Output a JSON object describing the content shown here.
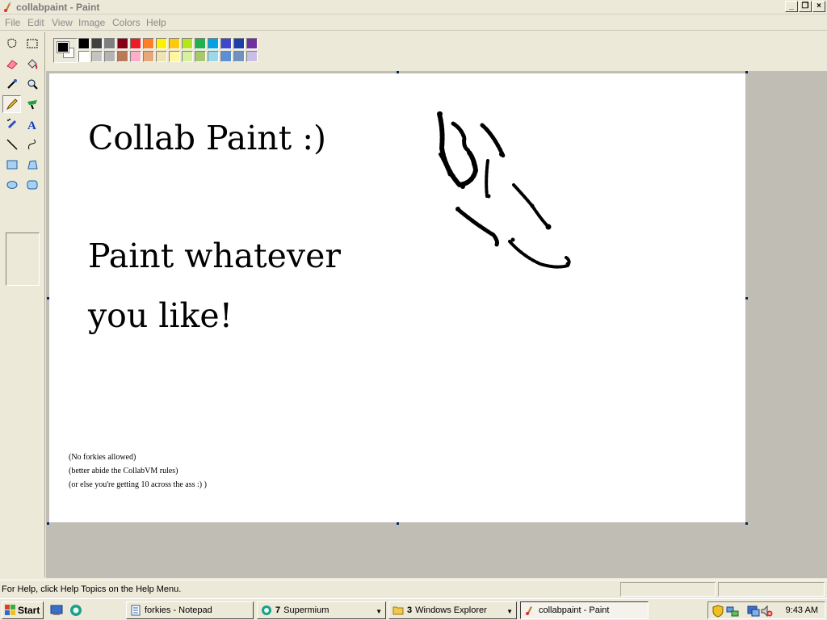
{
  "window": {
    "title": "collabpaint - Paint",
    "minimize_glyph": "_",
    "maximize_glyph": "❐",
    "close_glyph": "×"
  },
  "menu": [
    "File",
    "Edit",
    "View",
    "Image",
    "Colors",
    "Help"
  ],
  "tools": [
    {
      "name": "free-form-select-icon"
    },
    {
      "name": "select-icon"
    },
    {
      "name": "eraser-icon"
    },
    {
      "name": "fill-bucket-icon"
    },
    {
      "name": "color-picker-icon"
    },
    {
      "name": "magnifier-icon"
    },
    {
      "name": "pencil-icon",
      "active": true
    },
    {
      "name": "brush-icon"
    },
    {
      "name": "airbrush-icon"
    },
    {
      "name": "text-icon"
    },
    {
      "name": "line-icon"
    },
    {
      "name": "curve-icon"
    },
    {
      "name": "rectangle-icon"
    },
    {
      "name": "polygon-icon"
    },
    {
      "name": "ellipse-icon"
    },
    {
      "name": "rounded-rectangle-icon"
    }
  ],
  "palette": {
    "foreground": "#000000",
    "background": "#ffffff",
    "row1": [
      "#000000",
      "#404040",
      "#7f7f7f",
      "#880015",
      "#ed1c24",
      "#ff7f27",
      "#fff200",
      "#ffc90e",
      "#b5e61d",
      "#22b14c",
      "#00a2e8",
      "#3f48cc",
      "#1f3fa8",
      "#7030a0"
    ],
    "row2": [
      "#ffffff",
      "#c3c3c3",
      "#b4b4b4",
      "#b97a57",
      "#ffaec9",
      "#e6a878",
      "#efe4b0",
      "#fff6a0",
      "#d6f0a0",
      "#a8c870",
      "#99d9ea",
      "#5b8fd8",
      "#7092be",
      "#c8bfe7"
    ]
  },
  "canvas": {
    "line1": "Collab Paint :)",
    "line2": "Paint whatever",
    "line3": "you like!",
    "small1": "(No forkies allowed)",
    "small2": "(better abide the CollabVM rules)",
    "small3": "(or else you're getting 10 across the ass :) )"
  },
  "status": {
    "help_text": "For Help, click Help Topics on the Help Menu."
  },
  "taskbar": {
    "start_label": "Start",
    "buttons": [
      {
        "label": "forkies - Notepad",
        "count": "",
        "active": false
      },
      {
        "label": "Supermium",
        "count": "7",
        "active": false
      },
      {
        "label": "Windows Explorer",
        "count": "3",
        "active": false
      },
      {
        "label": "collabpaint - Paint",
        "count": "",
        "active": true
      }
    ],
    "clock": "9:43 AM"
  }
}
